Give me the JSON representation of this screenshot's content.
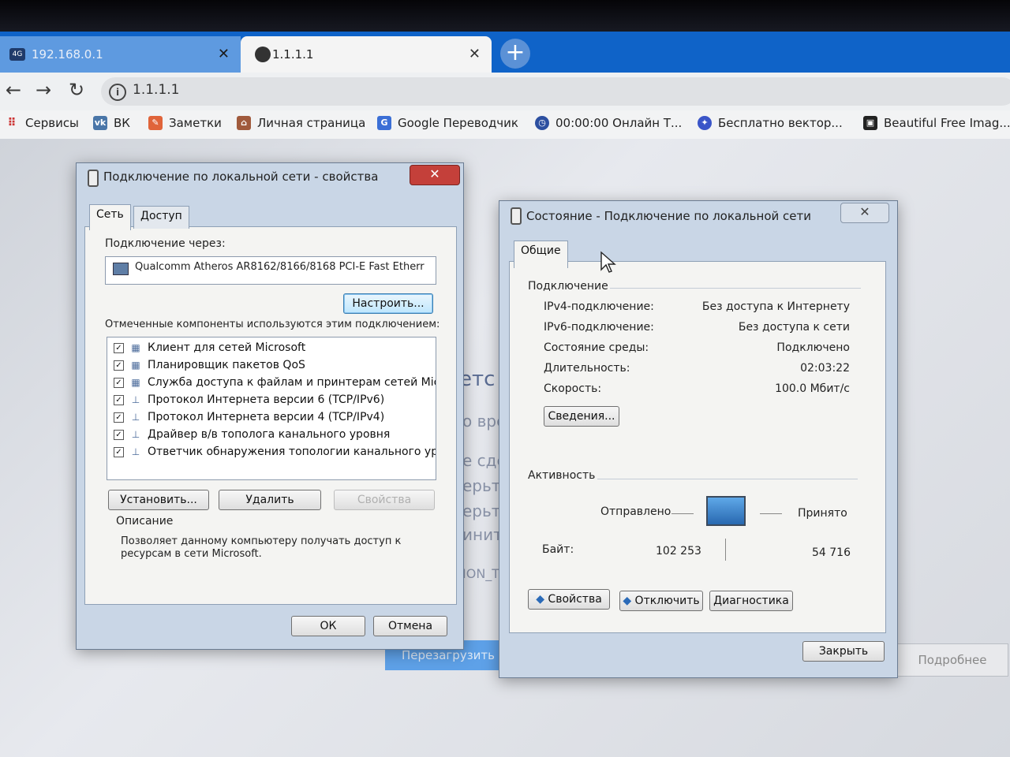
{
  "browser": {
    "tabs": [
      {
        "title": "192.168.0.1",
        "favicon": "4G"
      },
      {
        "title": "1.1.1.1"
      }
    ],
    "address": "1.1.1.1",
    "bookmarks": [
      {
        "label": "Сервисы"
      },
      {
        "label": "ВК"
      },
      {
        "label": "Заметки"
      },
      {
        "label": "Личная страница"
      },
      {
        "label": "Google Переводчик"
      },
      {
        "label": "00:00:00 Онлайн Т..."
      },
      {
        "label": "Бесплатно вектор..."
      },
      {
        "label": "Beautiful Free Imag..."
      }
    ]
  },
  "page": {
    "fragments": [
      "етс",
      "о вре",
      "е сде",
      "ерьте",
      "ерьте",
      "инит",
      "ION_T"
    ],
    "reload_button": "Перезагрузить",
    "more_button": "Подробнее"
  },
  "properties_dialog": {
    "title": "Подключение по локальной сети - свойства",
    "close": "✕",
    "tabs": [
      "Сеть",
      "Доступ"
    ],
    "connect_via_label": "Подключение через:",
    "adapter": "Qualcomm Atheros AR8162/8166/8168 PCI-E Fast Etherr",
    "configure_button": "Настроить...",
    "components_label": "Отмеченные компоненты используются этим подключением:",
    "components": [
      {
        "label": "Клиент для сетей Microsoft",
        "checked": true
      },
      {
        "label": "Планировщик пакетов QoS",
        "checked": true
      },
      {
        "label": "Служба доступа к файлам и принтерам сетей Micro...",
        "checked": true
      },
      {
        "label": "Протокол Интернета версии 6 (TCP/IPv6)",
        "checked": true
      },
      {
        "label": "Протокол Интернета версии 4 (TCP/IPv4)",
        "checked": true
      },
      {
        "label": "Драйвер в/в тополога канального уровня",
        "checked": true
      },
      {
        "label": "Ответчик обнаружения топологии канального уровня",
        "checked": true
      }
    ],
    "install_button": "Установить...",
    "remove_button": "Удалить",
    "properties_button": "Свойства",
    "description_label": "Описание",
    "description_text": "Позволяет данному компьютеру получать доступ к ресурсам в сети Microsoft.",
    "ok_button": "ОК",
    "cancel_button": "Отмена"
  },
  "status_dialog": {
    "title": "Состояние - Подключение по локальной сети",
    "tab": "Общие",
    "connection_label": "Подключение",
    "fields": [
      {
        "key": "IPv4-подключение:",
        "value": "Без доступа к Интернету"
      },
      {
        "key": "IPv6-подключение:",
        "value": "Без доступа к сети"
      },
      {
        "key": "Состояние среды:",
        "value": "Подключено"
      },
      {
        "key": "Длительность:",
        "value": "02:03:22"
      },
      {
        "key": "Скорость:",
        "value": "100.0 Мбит/с"
      }
    ],
    "details_button": "Сведения...",
    "activity_label": "Активность",
    "sent_label": "Отправлено",
    "received_label": "Принято",
    "bytes_label": "Байт:",
    "bytes_sent": "102 253",
    "bytes_received": "54 716",
    "properties_button": "Свойства",
    "disable_button": "Отключить",
    "diagnose_button": "Диагностика",
    "close_button": "Закрыть"
  }
}
